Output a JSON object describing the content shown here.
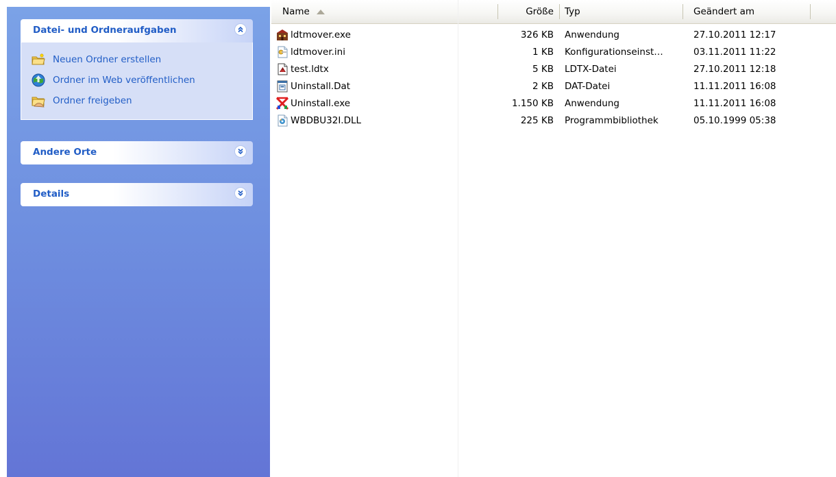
{
  "taskpane": {
    "file_tasks": {
      "title": "Datei- und Ordneraufgaben",
      "items": [
        {
          "label": "Neuen Ordner erstellen",
          "icon": "new-folder-icon"
        },
        {
          "label": "Ordner im Web veröffentlichen",
          "icon": "publish-web-icon"
        },
        {
          "label": "Ordner freigeben",
          "icon": "share-folder-icon"
        }
      ]
    },
    "other_places": {
      "title": "Andere Orte"
    },
    "details": {
      "title": "Details"
    }
  },
  "columns": {
    "name": "Name",
    "size": "Größe",
    "type": "Typ",
    "modified": "Geändert am"
  },
  "files": [
    {
      "name": "ldtmover.exe",
      "size": "326 KB",
      "type": "Anwendung",
      "modified": "27.10.2011 12:17",
      "icon": "app-exe-icon"
    },
    {
      "name": "ldtmover.ini",
      "size": "1 KB",
      "type": "Konfigurationseinst…",
      "modified": "03.11.2011 11:22",
      "icon": "config-file-icon"
    },
    {
      "name": "test.ldtx",
      "size": "5 KB",
      "type": "LDTX-Datei",
      "modified": "27.10.2011 12:18",
      "icon": "ldtx-file-icon"
    },
    {
      "name": "Uninstall.Dat",
      "size": "2 KB",
      "type": "DAT-Datei",
      "modified": "11.11.2011 16:08",
      "icon": "dat-file-icon"
    },
    {
      "name": "Uninstall.exe",
      "size": "1.150 KB",
      "type": "Anwendung",
      "modified": "11.11.2011 16:08",
      "icon": "uninstall-exe-icon"
    },
    {
      "name": "WBDBU32I.DLL",
      "size": "225 KB",
      "type": "Programmbibliothek",
      "modified": "05.10.1999 05:38",
      "icon": "dll-file-icon"
    }
  ],
  "colors": {
    "pane_link": "#215dc6",
    "pane_top": "#7ba2e7",
    "pane_bottom": "#6375d6",
    "panel_body": "#d6dff7"
  }
}
